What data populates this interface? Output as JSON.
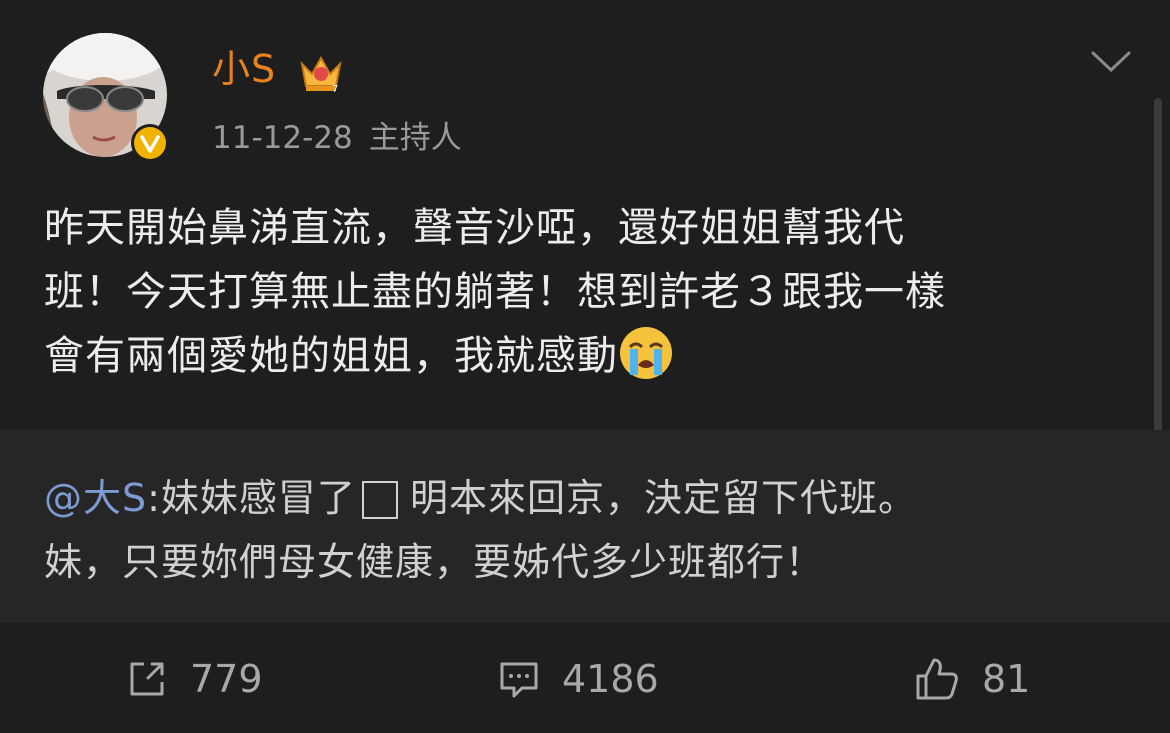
{
  "post": {
    "username": "小S",
    "date": "11-12-28",
    "role": "主持人",
    "text_lines": [
      "昨天開始鼻涕直流，聲音沙啞，還好姐姐幫我代",
      "班！今天打算無止盡的躺著！想到許老３跟我一樣",
      "會有兩個愛她的姐姐，我就感動"
    ],
    "emoji": "crying-face"
  },
  "repost": {
    "mention": "@大S",
    "line1_after_mention": ":妹妹感冒了",
    "line1_end": "明本來回京，決定留下代班。",
    "line2": "妹，只要妳們母女健康，要姊代多少班都行！"
  },
  "actions": {
    "repost_count": "779",
    "comment_count": "4186",
    "like_count": "81"
  },
  "colors": {
    "background": "#1e1e1e",
    "repost_background": "#262626",
    "username": "#e8821e",
    "mention": "#7d9ad2",
    "verified_badge": "#f0b400"
  },
  "icons": [
    "crown-icon",
    "verified-icon",
    "chevron-down-icon",
    "crying-face-icon",
    "share-icon",
    "comment-icon",
    "like-icon"
  ]
}
